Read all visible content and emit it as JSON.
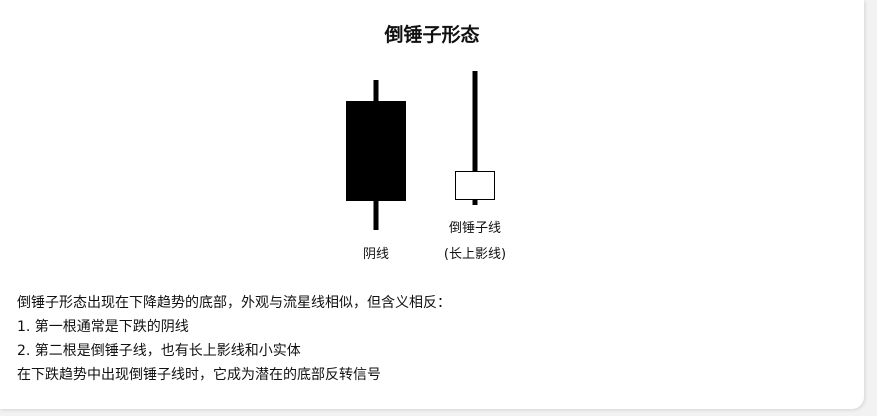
{
  "title": "倒锤子形态",
  "candles": {
    "bearish_label": "阴线",
    "hammer_label_line1": "倒锤子线",
    "hammer_label_line2": "(长上影线)",
    "colors": {
      "bearish_body": "#000000",
      "hammer_body": "#ffffff",
      "wick": "#000000"
    }
  },
  "description": {
    "line1": "倒锤子形态出现在下降趋势的底部，外观与流星线相似，但含义相反：",
    "line2": "1. 第一根通常是下跌的阴线",
    "line3": "2. 第二根是倒锤子线，也有长上影线和小实体",
    "line4": "在下跌趋势中出现倒锤子线时，它成为潜在的底部反转信号"
  }
}
